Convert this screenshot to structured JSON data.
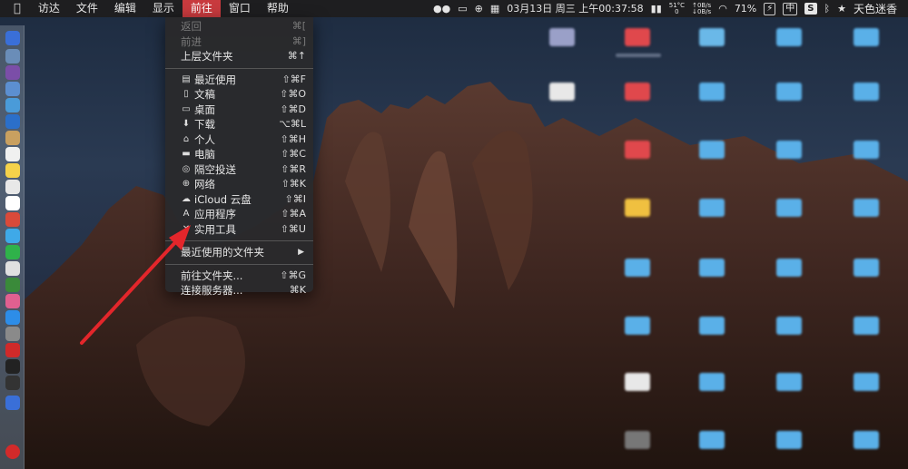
{
  "menubar": {
    "apple_icon": "apple-icon",
    "items": [
      "访达",
      "文件",
      "编辑",
      "显示",
      "前往",
      "窗口",
      "帮助"
    ],
    "active_index": 4,
    "status": {
      "temp_top": "51°C",
      "temp_bottom": "0",
      "net_up": "0B/s",
      "net_down": "0B/s",
      "clock": "03月13日 周三 上午00:37:58",
      "battery": "71%",
      "input_method": "中",
      "s_badge": "S",
      "user": "天色迷香"
    }
  },
  "go_menu": {
    "items": [
      {
        "label": "返回",
        "shortcut": "⌘[",
        "disabled": true
      },
      {
        "label": "前进",
        "shortcut": "⌘]",
        "disabled": true
      },
      {
        "label": "上层文件夹",
        "shortcut": "⌘↑",
        "disabled": false
      },
      {
        "label": "最近使用",
        "shortcut": "⇧⌘F",
        "icon": "recents-icon"
      },
      {
        "label": "文稿",
        "shortcut": "⇧⌘O",
        "icon": "documents-icon"
      },
      {
        "label": "桌面",
        "shortcut": "⇧⌘D",
        "icon": "desktop-icon"
      },
      {
        "label": "下载",
        "shortcut": "⌥⌘L",
        "icon": "downloads-icon"
      },
      {
        "label": "个人",
        "shortcut": "⇧⌘H",
        "icon": "home-icon"
      },
      {
        "label": "电脑",
        "shortcut": "⇧⌘C",
        "icon": "computer-icon"
      },
      {
        "label": "隔空投送",
        "shortcut": "⇧⌘R",
        "icon": "airdrop-icon"
      },
      {
        "label": "网络",
        "shortcut": "⇧⌘K",
        "icon": "network-icon"
      },
      {
        "label": "iCloud 云盘",
        "shortcut": "⇧⌘I",
        "icon": "icloud-icon"
      },
      {
        "label": "应用程序",
        "shortcut": "⇧⌘A",
        "icon": "applications-icon"
      },
      {
        "label": "实用工具",
        "shortcut": "⇧⌘U",
        "icon": "utilities-icon"
      },
      {
        "label": "最近使用的文件夹",
        "shortcut": "▶"
      },
      {
        "label": "前往文件夹...",
        "shortcut": "⇧⌘G"
      },
      {
        "label": "连接服务器...",
        "shortcut": "⌘K"
      }
    ]
  },
  "colors": {
    "menubar_bg": "#1e1e20",
    "active_menu": "#c83a3e",
    "annotation_arrow": "#e3262b"
  }
}
